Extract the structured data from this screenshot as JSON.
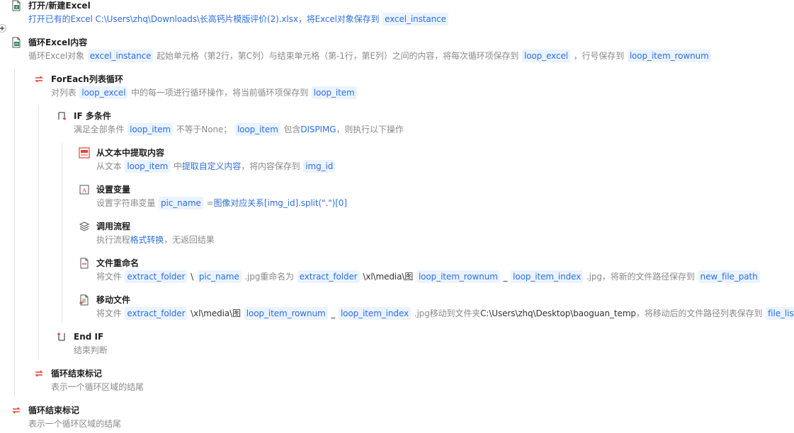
{
  "steps": {
    "open_excel": {
      "title": "打开/新建Excel",
      "desc_text": "打开已有的Excel C:\\Users\\zhq\\Downloads\\长高钙片模版评价(2).xlsx，将Excel对象保存到",
      "var": "excel_instance",
      "icon": "excel-file-icon"
    },
    "loop_excel": {
      "title": "循环Excel内容",
      "t1": "循环Excel对象",
      "v1": "excel_instance",
      "t2": "起始单元格（第2行，第C列）与结束单元格（第-1行，第E列）之间的内容，将每次循环项保存到",
      "v2": "loop_excel",
      "t3": "，行号保存到",
      "v3": "loop_item_rownum",
      "icon": "excel-loop-icon"
    },
    "foreach": {
      "title": "ForEach列表循环",
      "t1": "对列表",
      "v1": "loop_excel",
      "t2": "中的每一项进行循环操作，将当前循环项保存到",
      "v2": "loop_item",
      "icon": "loop-icon"
    },
    "if_multi": {
      "title": "IF 多条件",
      "t1": "满足全部条件",
      "v1": "loop_item",
      "t2": "不等于None；",
      "v2": "loop_item",
      "t3": "包含",
      "t4": "DISPIMG",
      "t5": "，则执行以下操作",
      "icon": "branch-icon"
    },
    "extract": {
      "title": "从文本中提取内容",
      "t1": "从文本",
      "v1": "loop_item",
      "t2": "中",
      "t3": "提取自定义内容",
      "t4": "，将内容保存到",
      "v2": "img_id",
      "icon": "extract-text-icon"
    },
    "set_var": {
      "title": "设置变量",
      "t1": "设置字符串变量",
      "v1": "pic_name",
      "t2": "=",
      "t3": "图像对应关系[img_id].split(\".\")[0]",
      "icon": "variable-icon"
    },
    "call_flow": {
      "title": "调用流程",
      "t1": "执行流程",
      "t2": "格式转换",
      "t3": "，无返回结果",
      "icon": "layers-icon"
    },
    "rename": {
      "title": "文件重命名",
      "t1": "将文件",
      "v1": "extract_folder",
      "t2": "\\",
      "v2": "pic_name",
      "t3": ".jpg重命名为",
      "v3": "extract_folder",
      "t4": "\\xl\\media\\图",
      "v4": "loop_item_rownum",
      "t5": "_",
      "v5": "loop_item_index",
      "t6": ".jpg，将新的文件路径保存到",
      "v6": "new_file_path",
      "icon": "rename-file-icon"
    },
    "move": {
      "title": "移动文件",
      "t1": "将文件",
      "v1": "extract_folder",
      "t2": "\\xl\\media\\图",
      "v2": "loop_item_rownum",
      "t3": "_",
      "v3": "loop_item_index",
      "t4": ".jpg移动到文件夹",
      "t5": "C:\\Users\\zhq\\Desktop\\baoguan_temp",
      "t6": "，将移动后的文件路径列表保存到",
      "v4": "file_list",
      "icon": "move-file-icon"
    },
    "end_if": {
      "title": "End IF",
      "desc": "结束判断",
      "icon": "end-branch-icon"
    },
    "loop_end_inner": {
      "title": "循环结束标记",
      "desc": "表示一个循环区域的结尾",
      "icon": "loop-end-icon"
    },
    "loop_end_outer": {
      "title": "循环结束标记",
      "desc": "表示一个循环区域的结尾",
      "icon": "loop-end-icon"
    }
  },
  "colors": {
    "accent": "#2f6fe0",
    "tag_bg": "#eaf3ff",
    "desc": "#8a8a8a",
    "title": "#1f1f1f",
    "icon_red": "#e0443a"
  }
}
